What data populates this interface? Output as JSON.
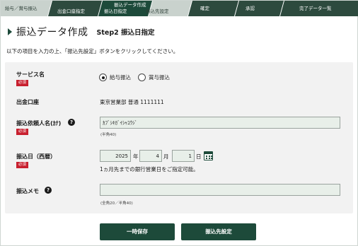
{
  "steps": [
    {
      "label": "給与／賞与振込",
      "state": "done"
    },
    {
      "label": "出金口座指定",
      "state": "done"
    },
    {
      "label": "振込データ作成",
      "label2": "振込日指定",
      "state": "current"
    },
    {
      "label": "振込先設定",
      "state": "pending"
    },
    {
      "label": "確定",
      "state": "pending"
    },
    {
      "label": "承認",
      "state": "pending"
    },
    {
      "label": "完了データ一覧",
      "state": "pending"
    }
  ],
  "page": {
    "title": "振込データ作成",
    "step_title": "Step2 振込日指定",
    "instruction": "以下の項目を入力の上、「振込先設定」ボタンをクリックしてください。"
  },
  "form": {
    "required_badge": "必須",
    "service": {
      "label": "サービス名",
      "options": [
        {
          "label": "給与振込",
          "selected": true
        },
        {
          "label": "賞与振込",
          "selected": false
        }
      ]
    },
    "account": {
      "label": "出金口座",
      "value": "東京営業部 普通 1111111"
    },
    "requester": {
      "label": "振込依頼人名(ｶﾅ)",
      "help": "?",
      "value": "ｶﾌﾞｼｷｶﾞｲｼｬｺｳｼﾞ",
      "hint": "(半角40)"
    },
    "date": {
      "label": "振込日（西暦）",
      "year": "2025",
      "year_unit": "年",
      "month": "4",
      "month_unit": "月",
      "day": "1",
      "day_unit": "日",
      "note": "1ヵ月先までの銀行営業日をご指定可能。"
    },
    "memo": {
      "label": "振込メモ",
      "help": "?",
      "value": "",
      "hint": "(全角20／半角40)"
    }
  },
  "buttons": {
    "save": "一時保存",
    "next": "振込先設定"
  },
  "colors": {
    "primary": "#1d4a3a",
    "step_done": "#2d4a3e",
    "step_pending": "#c9d2cd",
    "required": "#c8202f",
    "panel_bg": "#f2f2f2",
    "input_bg": "#e8efe9"
  }
}
